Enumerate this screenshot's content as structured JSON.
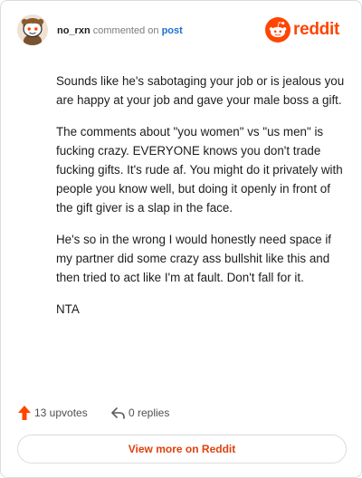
{
  "header": {
    "username": "no_rxn",
    "action_text": "commented on",
    "post_link": "post",
    "brand_name": "reddit"
  },
  "comment": {
    "paragraphs": [
      "Sounds like he's sabotaging your job or is jealous you are happy at your job and gave your male boss a gift.",
      "The comments about \"you women\" vs \"us men\" is fucking crazy. EVERYONE knows you don't trade fucking gifts. It's rude af. You might do it privately with people you know well, but doing it openly in front of the gift giver is a slap in the face.",
      "He's so in the wrong I would honestly need space if my partner did some crazy ass bullshit like this and then tried to act like I'm at fault. Don't fall for it.",
      "NTA"
    ]
  },
  "footer": {
    "upvotes_label": "13 upvotes",
    "replies_label": "0 replies",
    "view_more_label": "View more on Reddit"
  },
  "colors": {
    "brand": "#ff4500",
    "link": "#1c6fd1",
    "upvote": "#ff4500",
    "button_text": "#e0410d"
  },
  "icons": {
    "avatar": "snoo-avatar",
    "logo": "reddit-logo-icon",
    "upvote": "upvote-arrow-icon",
    "reply": "reply-arrow-icon"
  }
}
